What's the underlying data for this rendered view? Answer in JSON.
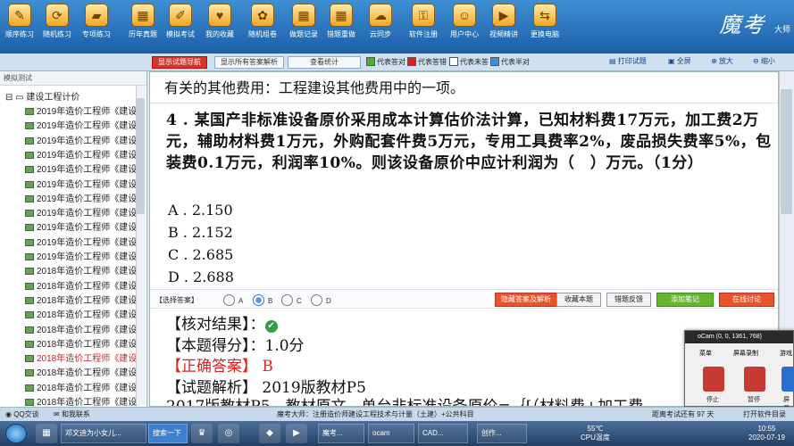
{
  "toolbar": {
    "items": [
      {
        "label": "顺序练习",
        "icon": "document-icon"
      },
      {
        "label": "随机练习",
        "icon": "refresh-icon"
      },
      {
        "label": "专项练习",
        "icon": "folder-icon"
      },
      {
        "label": "历年真题",
        "icon": "calendar-icon"
      },
      {
        "label": "模拟考试",
        "icon": "pencil-icon"
      },
      {
        "label": "我的收藏",
        "icon": "heart-icon"
      },
      {
        "label": "随机组卷",
        "icon": "flower-icon"
      },
      {
        "label": "做题记录",
        "icon": "calendar-icon"
      },
      {
        "label": "错题重做",
        "icon": "calendar-icon"
      },
      {
        "label": "云同步",
        "icon": "cloud-icon"
      },
      {
        "label": "软件注册",
        "icon": "lock-icon"
      },
      {
        "label": "用户中心",
        "icon": "user-icon"
      },
      {
        "label": "视频精讲",
        "icon": "film-icon"
      },
      {
        "label": "更换电脑",
        "icon": "swap-icon"
      }
    ],
    "brand": "魔考",
    "brand_sub": "大师"
  },
  "subbar": {
    "btn_show_nav": "显示试题导航",
    "btn_show_all": "显示所有答案解析",
    "btn_stats": "查看统计",
    "legend": [
      {
        "label": "代表答对",
        "color": "#49b233"
      },
      {
        "label": "代表答错",
        "color": "#d9201c"
      },
      {
        "label": "代表未答",
        "color": "#ffffff"
      },
      {
        "label": "代表半对",
        "color": "#3c8fd9"
      }
    ],
    "print": "打印试题",
    "fullscreen": "全屏",
    "zoom_in": "放大",
    "zoom_out": "缩小"
  },
  "sidebar": {
    "header": "模拟测试",
    "root": "建设工程计价",
    "items": [
      "2019年造价工程师《建设",
      "2019年造价工程师《建设",
      "2019年造价工程师《建设",
      "2019年造价工程师《建设",
      "2019年造价工程师《建设",
      "2019年造价工程师《建设",
      "2019年造价工程师《建设",
      "2019年造价工程师《建设",
      "2019年造价工程师《建设",
      "2019年造价工程师《建设",
      "2019年造价工程师《建设",
      "2018年造价工程师《建设",
      "2018年造价工程师《建设",
      "2018年造价工程师《建设",
      "2018年造价工程师《建设",
      "2018年造价工程师《建设",
      "2018年造价工程师《建设",
      "2018年造价工程师《建设",
      "2018年造价工程师《建设",
      "2018年造价工程师《建设",
      "2018年造价工程师《建设"
    ],
    "selected_index": 17
  },
  "main": {
    "prev_text": "有关的其他费用：工程建设其他费用中的一项。",
    "question": "4 . 某国产非标准设备原价采用成本计算估价法计算，已知材料费17万元，加工费2万元，辅助材料费1万元，外购配套件费5万元，专用工具费率2%，废品损失费率5%，包装费0.1万元，利润率10%。则该设备原价中应计利润为（　）万元。（1分）",
    "options": [
      "A . 2.150",
      "B . 2.152",
      "C . 2.685",
      "D . 2.688"
    ],
    "answer_label": "【选择答案】",
    "radio_labels": [
      "A",
      "B",
      "C",
      "D"
    ],
    "selected_option": "B",
    "buttons": {
      "hide": "隐藏答案及解析",
      "collect": "收藏本题",
      "feedback": "错题反馈",
      "note": "添加笔记",
      "discuss": "在线讨论"
    },
    "result_label": "【核对结果】：",
    "score": "【本题得分】：1.0分",
    "correct": "【正确答案】 B",
    "analysis": "【试题解析】 2019版教材P5",
    "analysis_cont": "2017版教材P5，教材原文，单台非标准设备原价=｛[（材料费+加工费"
  },
  "ocam": {
    "title": "oCam (0, 0, 1361, 768)",
    "tabs": [
      "菜单",
      "屏幕录制",
      "游戏"
    ],
    "buttons": [
      "停止",
      "暂停",
      "屏幕"
    ]
  },
  "statusbar": {
    "qq": "QQ交谈",
    "contact": "和我联系",
    "center": "魔考大师：注册造价师建设工程技术与计量（土建）+公共科目",
    "exam_days": "距离考试还有 97 天",
    "open_dir": "打开软件目录"
  },
  "taskbar": {
    "search": "搜索一下",
    "apps": [
      "邓文迪为小女儿...",
      "魔考...",
      "ocam",
      "CAD...",
      "创作..."
    ],
    "temp": "55℃",
    "cpu": "CPU温度",
    "time": "10:55",
    "date": "2020-07-19"
  }
}
